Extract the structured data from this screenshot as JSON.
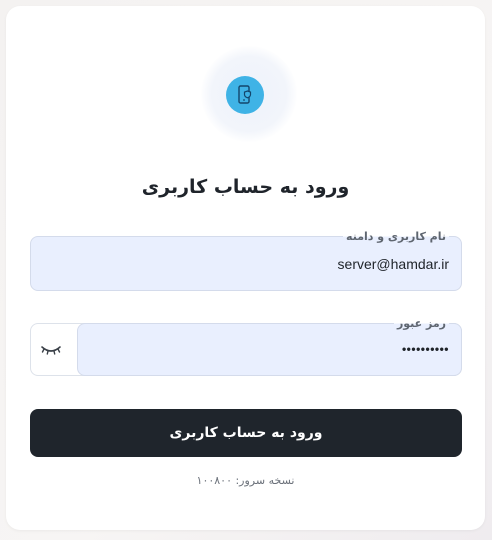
{
  "login": {
    "title": "ورود به حساب کاربری",
    "icon": "mobile-shield-icon",
    "username": {
      "label": "نام کاربری و دامنه",
      "value": "server@hamdar.ir"
    },
    "password": {
      "label": "رمز عبور",
      "masked_value": "••••••••••",
      "toggle_icon": "eye-closed-icon"
    },
    "submit_label": "ورود به حساب کاربری",
    "server_version": "نسخه سرور: ۱۰۰۸۰۰"
  },
  "colors": {
    "accent": "#3fb3e6",
    "button": "#1f252c",
    "field_bg": "#e9effe"
  }
}
